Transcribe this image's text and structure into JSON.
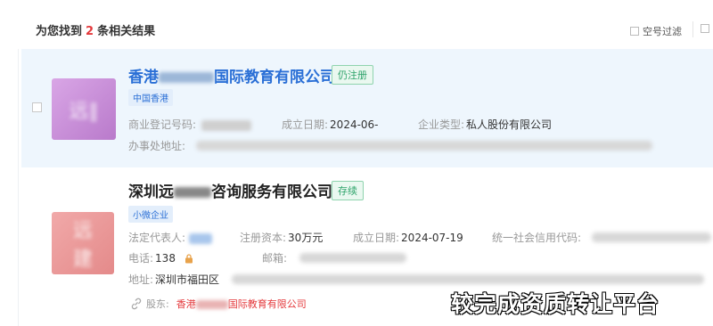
{
  "header": {
    "count_prefix": "为您找到",
    "count": "2",
    "count_suffix": "条相关结果",
    "filter_label": "空号过滤"
  },
  "results": [
    {
      "name_prefix": "香港",
      "name_suffix": "国际教育有限公司",
      "status": "仍注册",
      "tag": "中国香港",
      "fields": [
        {
          "label": "商业登记号码:",
          "value": ""
        },
        {
          "label": "成立日期:",
          "value": "2024-06-"
        },
        {
          "label": "企业类型:",
          "value": "私人股份有限公司"
        },
        {
          "label": "办事处地址:",
          "value": ""
        }
      ]
    },
    {
      "name_prefix": "深圳远",
      "name_suffix": "咨询服务有限公司",
      "status": "存续",
      "tag": "小微企业",
      "fields": [
        {
          "label": "法定代表人:",
          "value": ""
        },
        {
          "label": "注册资本:",
          "value": "30万元"
        },
        {
          "label": "成立日期:",
          "value": "2024-07-19"
        },
        {
          "label": "统一社会信用代码:",
          "value": ""
        },
        {
          "label": "电话:",
          "value": "138"
        },
        {
          "label": "邮箱:",
          "value": ""
        },
        {
          "label": "地址:",
          "value": "深圳市福田区"
        }
      ],
      "shareholder_label": "股东:",
      "shareholder_prefix": "香港",
      "shareholder_suffix": "国际教育有限公司"
    }
  ],
  "watermark": "较完成资质转让平台",
  "colors": {
    "accent_blue": "#2a6fd6",
    "status_green": "#2ea36a",
    "count_red": "#e4393c",
    "card_highlight": "#eef6fd"
  },
  "icons": {
    "lock": "lock-icon",
    "link": "link-icon"
  }
}
